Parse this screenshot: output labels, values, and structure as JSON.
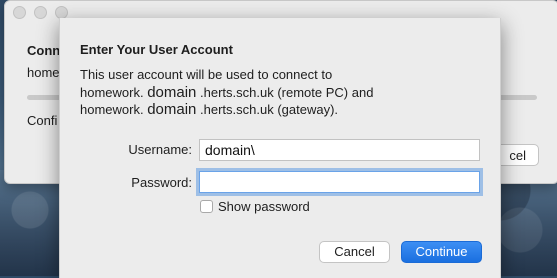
{
  "background_window": {
    "title_partial": "Conn",
    "line1_partial": "home",
    "line2_partial": "Confi",
    "cancel_partial": "cel"
  },
  "dialog": {
    "title": "Enter Your User Account",
    "description_line1": "This user account will be used to connect to",
    "desc_line2_prefix": "homework.",
    "desc_line2_domain": "domain",
    "desc_line2_suffix": ".herts.sch.uk (remote PC) and",
    "desc_line3_prefix": "homework.",
    "desc_line3_domain": "domain",
    "desc_line3_suffix": ".herts.sch.uk (gateway).",
    "username_label": "Username:",
    "username_value": "domain\\",
    "password_label": "Password:",
    "password_value": "",
    "show_password_label": "Show password",
    "show_password_checked": false,
    "cancel_label": "Cancel",
    "continue_label": "Continue"
  },
  "colors": {
    "accent": "#1a6fe0",
    "focus_ring": "#5e9ae2"
  }
}
